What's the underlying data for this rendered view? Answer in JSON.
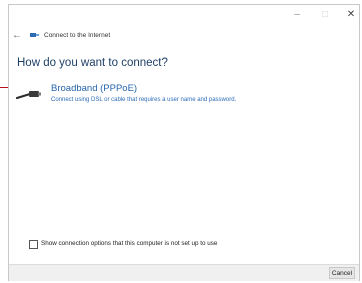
{
  "window": {
    "title": "Connect to the Internet",
    "minimize_glyph": "–",
    "maximize_glyph": "□",
    "close_glyph": "✕",
    "back_glyph": "←"
  },
  "heading": "How do you want to connect?",
  "options": [
    {
      "title": "Broadband (PPPoE)",
      "description": "Connect using DSL or cable that requires a user name and password.",
      "icon": "broadband-cable-icon"
    }
  ],
  "checkbox": {
    "label": "Show connection options that this computer is not set up to use",
    "checked": false
  },
  "footer": {
    "cancel_label": "Cancel"
  },
  "colors": {
    "link_blue": "#2565ad",
    "heading_blue": "#1e3f66",
    "pointer_red": "#b5121b"
  }
}
